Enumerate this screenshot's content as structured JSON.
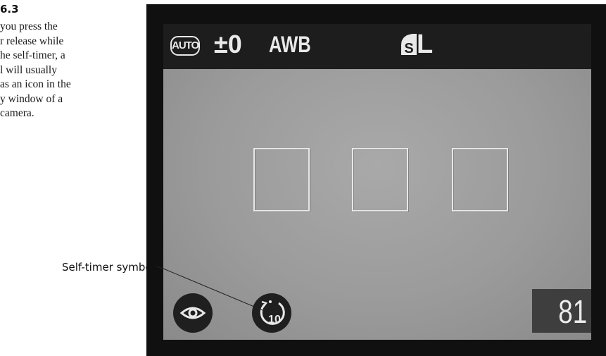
{
  "figure": {
    "label": "6.3",
    "caption_lines": [
      "you press the",
      "r release while",
      "he self-timer, a",
      "l will usually",
      "as an icon in the",
      "y window of a",
      "camera."
    ]
  },
  "callout": {
    "label": "Self-timer symbol"
  },
  "lcd": {
    "mode": "AUTO",
    "exposure_comp": "±0",
    "white_balance": "AWB",
    "quality_icon": "superfine-quality-icon",
    "image_size": "L",
    "shots_remaining": "81",
    "self_timer_seconds": "10",
    "af_frame_count": 3,
    "icons": [
      "eye-icon",
      "self-timer-icon"
    ]
  }
}
